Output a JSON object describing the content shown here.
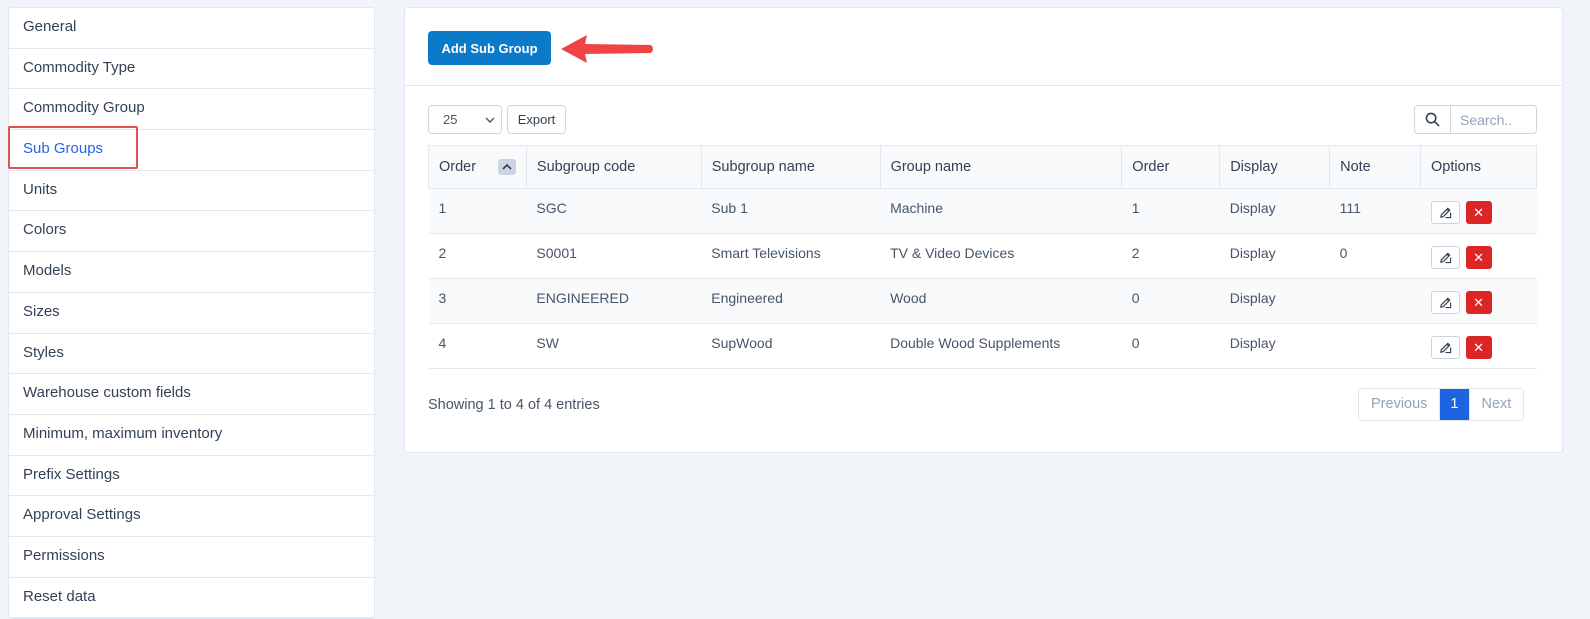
{
  "sidebar": {
    "items": [
      {
        "label": "General"
      },
      {
        "label": "Commodity Type"
      },
      {
        "label": "Commodity Group"
      },
      {
        "label": "Sub Groups"
      },
      {
        "label": "Units"
      },
      {
        "label": "Colors"
      },
      {
        "label": "Models"
      },
      {
        "label": "Sizes"
      },
      {
        "label": "Styles"
      },
      {
        "label": "Warehouse custom fields"
      },
      {
        "label": "Minimum, maximum inventory"
      },
      {
        "label": "Prefix Settings"
      },
      {
        "label": "Approval Settings"
      },
      {
        "label": "Permissions"
      },
      {
        "label": "Reset data"
      }
    ],
    "active_index": 3
  },
  "toolbar": {
    "add_label": "Add Sub Group",
    "page_length": "25",
    "export_label": "Export",
    "search_placeholder": "Search.."
  },
  "table": {
    "headers": [
      "Order",
      "Subgroup code",
      "Subgroup name",
      "Group name",
      "Order",
      "Display",
      "Note",
      "Options"
    ],
    "rows": [
      {
        "order": "1",
        "code": "SGC",
        "name": "Sub 1",
        "group": "Machine",
        "order2": "1",
        "display": "Display",
        "note": "111"
      },
      {
        "order": "2",
        "code": "S0001",
        "name": "Smart Televisions",
        "group": "TV & Video Devices",
        "order2": "2",
        "display": "Display",
        "note": "0"
      },
      {
        "order": "3",
        "code": "ENGINEERED",
        "name": "Engineered",
        "group": "Wood",
        "order2": "0",
        "display": "Display",
        "note": ""
      },
      {
        "order": "4",
        "code": "SW",
        "name": "SupWood",
        "group": "Double Wood Supplements",
        "order2": "0",
        "display": "Display",
        "note": ""
      }
    ]
  },
  "footer": {
    "showing": "Showing 1 to 4 of 4 entries",
    "previous": "Previous",
    "page": "1",
    "next": "Next"
  },
  "colors": {
    "primary_button": "#0b7bc9",
    "annotation_red": "#e05252",
    "delete_red": "#dc2626",
    "active_page": "#1d64e0"
  },
  "icons": [
    "search-icon",
    "chevron-down-icon",
    "chevron-up-icon",
    "edit-icon",
    "close-icon",
    "arrow-left-icon"
  ]
}
